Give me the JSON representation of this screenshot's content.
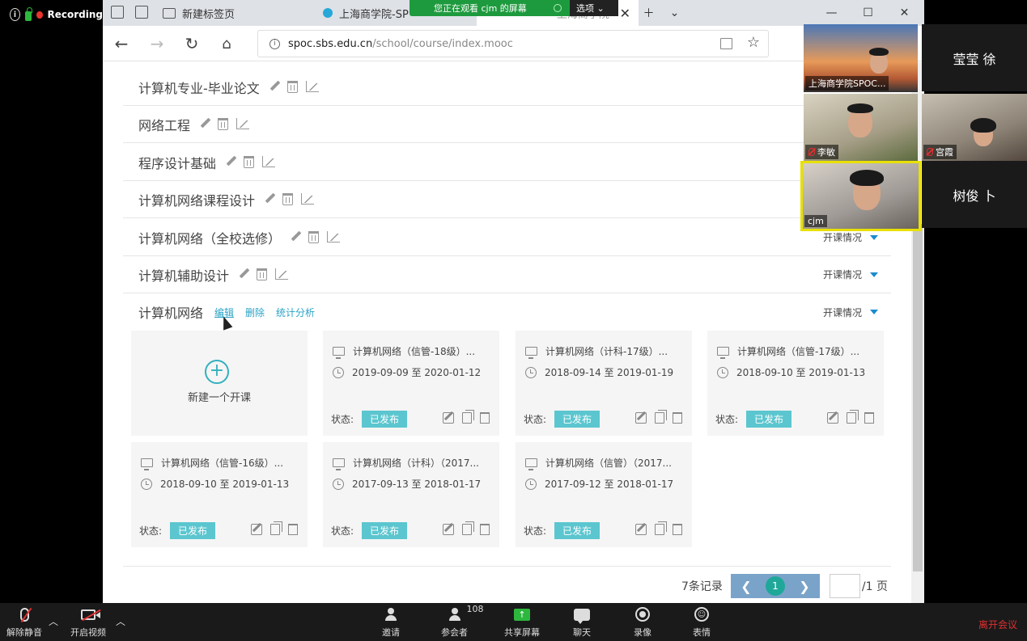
{
  "zoom": {
    "recording_label": "Recording",
    "share_banner": "您正在观看 cjm 的屏幕",
    "share_options": "选项 ⌄",
    "leave_label": "离开会议",
    "toolbar": [
      {
        "label": "解除静音",
        "icon": "mic-muted-icon"
      },
      {
        "label": "开启视频",
        "icon": "camera-off-icon"
      },
      {
        "label": "邀请",
        "icon": "invite-icon"
      },
      {
        "label": "参会者",
        "icon": "participants-icon",
        "count": "108"
      },
      {
        "label": "共享屏幕",
        "icon": "share-screen-icon"
      },
      {
        "label": "聊天",
        "icon": "chat-icon"
      },
      {
        "label": "录像",
        "icon": "record-icon"
      },
      {
        "label": "表情",
        "icon": "emoji-icon"
      }
    ],
    "participants": [
      {
        "name": "上海商学院SPOC...",
        "video": true
      },
      {
        "name": "莹莹 徐",
        "video": false
      },
      {
        "name": "李敏",
        "video": true
      },
      {
        "name": "宫霞",
        "video": true
      },
      {
        "name": "cjm",
        "video": true,
        "active": true
      },
      {
        "name": "树俊 卜",
        "video": false
      }
    ]
  },
  "browser": {
    "tabs": [
      {
        "title": "新建标签页"
      },
      {
        "title": "上海商学院-SP"
      },
      {
        "title": "上海商学院-"
      }
    ],
    "url_host": "spoc.sbs.edu.cn",
    "url_path": "/school/course/index.mooc"
  },
  "page": {
    "courses": [
      {
        "title": "计算机专业-毕业论文"
      },
      {
        "title": "网络工程"
      },
      {
        "title": "程序设计基础"
      },
      {
        "title": "计算机网络课程设计"
      },
      {
        "title": "计算机网络（全校选修）",
        "kaike": "开课情况"
      },
      {
        "title": "计算机辅助设计",
        "kaike": "开课情况"
      }
    ],
    "expanded_course": {
      "title": "计算机网络",
      "links": [
        "编辑",
        "删除",
        "统计分析"
      ],
      "kaike": "开课情况",
      "new_label": "新建一个开课",
      "status_label": "状态:",
      "sections": [
        {
          "name": "计算机网络（信管-18级）...",
          "dates": "2019-09-09 至 2020-01-12",
          "status": "已发布"
        },
        {
          "name": "计算机网络（计科-17级）...",
          "dates": "2018-09-14 至 2019-01-19",
          "status": "已发布"
        },
        {
          "name": "计算机网络（信管-17级）...",
          "dates": "2018-09-10 至 2019-01-13",
          "status": "已发布"
        },
        {
          "name": "计算机网络（信管-16级）...",
          "dates": "2018-09-10 至 2019-01-13",
          "status": "已发布"
        },
        {
          "name": "计算机网络（计科）（2017...",
          "dates": "2017-09-13 至 2018-01-17",
          "status": "已发布"
        },
        {
          "name": "计算机网络（信管）（2017...",
          "dates": "2017-09-12 至 2018-01-17",
          "status": "已发布"
        }
      ]
    },
    "pager": {
      "records": "7条记录",
      "prev": "❮",
      "current": "1",
      "next": "❯",
      "total": "/1 页"
    }
  }
}
